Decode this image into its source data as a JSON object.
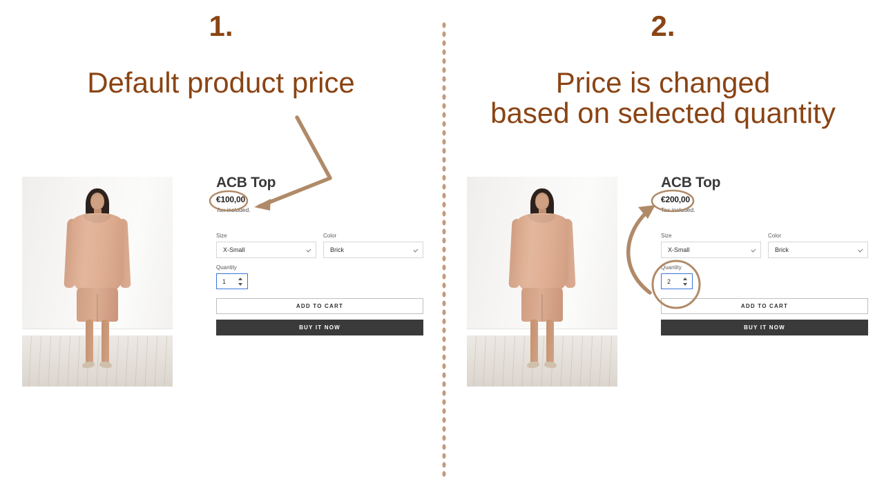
{
  "palette": {
    "heading_brown": "#8a4414",
    "annotation_tan": "#b08a68",
    "button_dark": "#3a3a3a",
    "focus_blue": "#3b74d8",
    "divider_dot": "#c49a7c"
  },
  "divider": {
    "style": "vertical-dotted-line"
  },
  "panels": [
    {
      "id": "left",
      "step_number": "1.",
      "step_title": "Default product price",
      "photo": {
        "alt": "model-wearing-blush-top-and-shorts"
      },
      "product": {
        "title": "ACB Top",
        "price": "€100,00",
        "tax_note": "Tax included.",
        "options": [
          {
            "label": "Size",
            "value": "X-Small"
          },
          {
            "label": "Color",
            "value": "Brick"
          }
        ],
        "quantity": {
          "label": "Quantity",
          "value": "1"
        },
        "buttons": {
          "add_to_cart": "ADD TO CART",
          "buy_it_now": "BUY IT NOW"
        }
      },
      "annotations": {
        "circle_target": "price",
        "arrow": "bent-arrow-pointing-to-price"
      }
    },
    {
      "id": "right",
      "step_number": "2.",
      "step_title": "Price is changed\nbased on selected quantity",
      "photo": {
        "alt": "model-wearing-blush-top-and-shorts"
      },
      "product": {
        "title": "ACB Top",
        "price": "€200,00",
        "tax_note": "Tax included.",
        "options": [
          {
            "label": "Size",
            "value": "X-Small"
          },
          {
            "label": "Color",
            "value": "Brick"
          }
        ],
        "quantity": {
          "label": "Quantity",
          "value": "2"
        },
        "buttons": {
          "add_to_cart": "ADD TO CART",
          "buy_it_now": "BUY IT NOW"
        }
      },
      "annotations": {
        "circle_targets": [
          "price",
          "quantity"
        ],
        "arrow": "curved-arrow-from-quantity-to-price"
      }
    }
  ]
}
